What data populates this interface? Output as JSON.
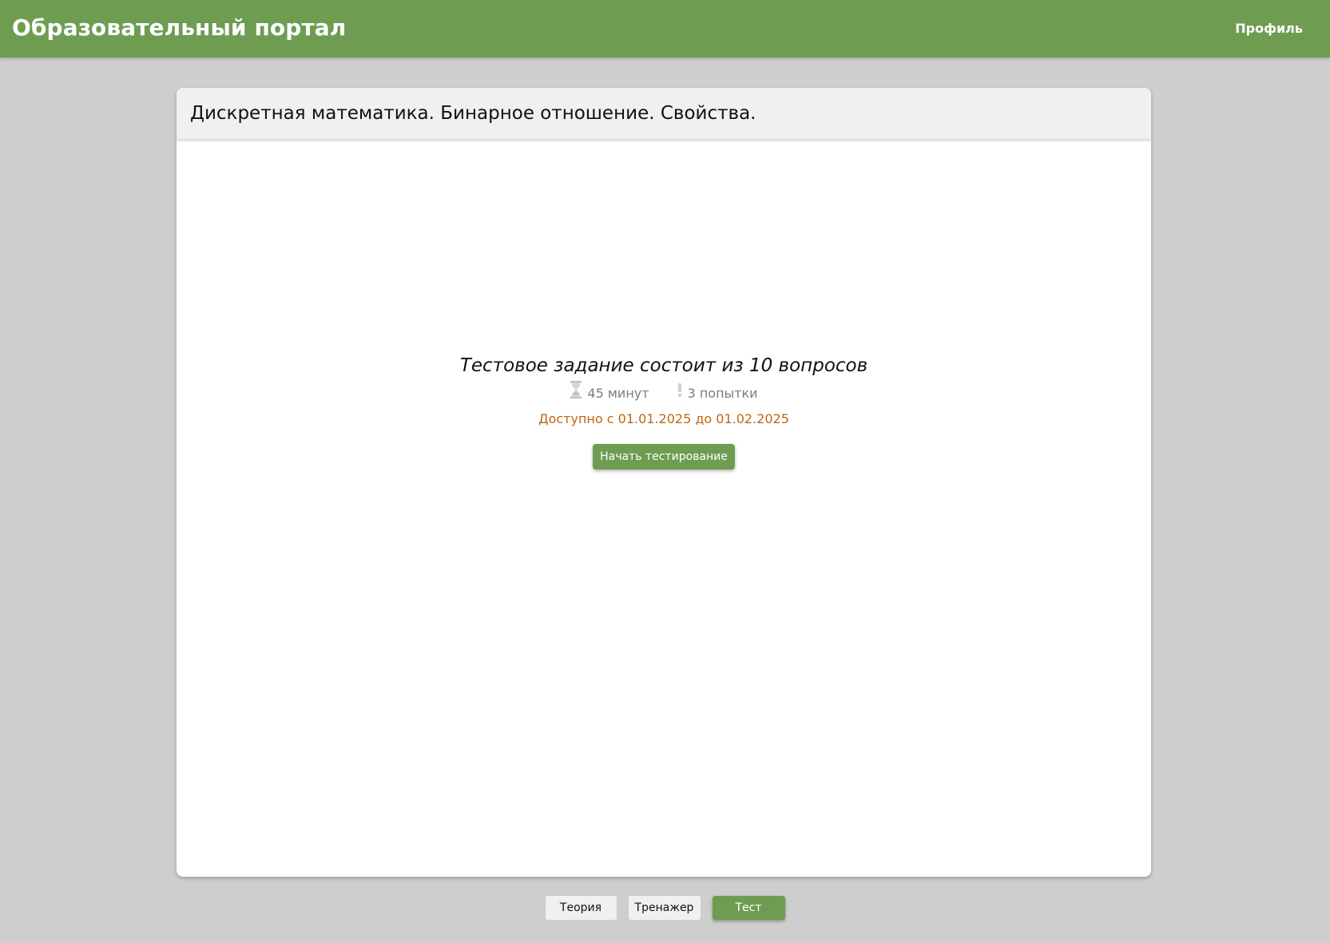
{
  "header": {
    "app_title": "Образовательный портал",
    "profile_label": "Профиль"
  },
  "course": {
    "title": "Дискретная математика. Бинарное отношение. Свойства."
  },
  "test": {
    "heading": "Тестовое задание состоит из 10 вопросов",
    "duration_icon": "hourglass-icon",
    "duration": "45 минут",
    "attempts_icon": "exclamation-icon",
    "attempts": "3 попытки",
    "availability": "Доступно с 01.01.2025 до 01.02.2025",
    "start_button": "Начать тестирование"
  },
  "tabs": [
    {
      "label": "Теория",
      "active": false
    },
    {
      "label": "Тренажер",
      "active": false
    },
    {
      "label": "Тест",
      "active": true
    }
  ],
  "colors": {
    "accent": "#6e9d52",
    "background": "#cecece",
    "availability": "#c0660f",
    "muted": "#7c7c7c"
  }
}
